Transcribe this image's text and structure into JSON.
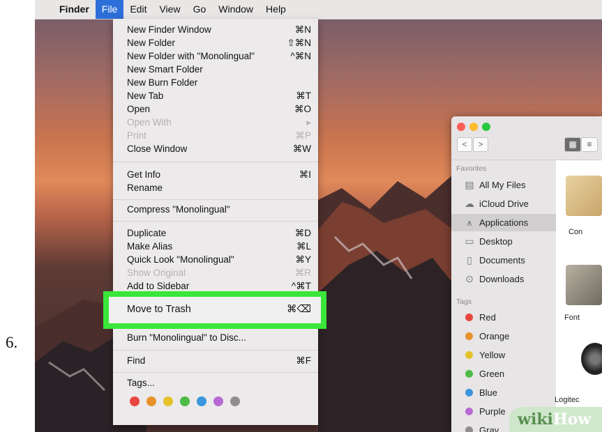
{
  "step_number": "6.",
  "menubar": {
    "apple": "",
    "app": "Finder",
    "items": [
      "File",
      "Edit",
      "View",
      "Go",
      "Window",
      "Help"
    ]
  },
  "file_menu": {
    "groups": [
      [
        {
          "label": "New Finder Window",
          "shortcut": "⌘N",
          "enabled": true
        },
        {
          "label": "New Folder",
          "shortcut": "⇧⌘N",
          "enabled": true
        },
        {
          "label": "New Folder with \"Monolingual\"",
          "shortcut": "^⌘N",
          "enabled": true
        },
        {
          "label": "New Smart Folder",
          "shortcut": "",
          "enabled": true
        },
        {
          "label": "New Burn Folder",
          "shortcut": "",
          "enabled": true
        },
        {
          "label": "New Tab",
          "shortcut": "⌘T",
          "enabled": true
        },
        {
          "label": "Open",
          "shortcut": "⌘O",
          "enabled": true
        },
        {
          "label": "Open With",
          "shortcut": "▸",
          "enabled": false
        },
        {
          "label": "Print",
          "shortcut": "⌘P",
          "enabled": false
        },
        {
          "label": "Close Window",
          "shortcut": "⌘W",
          "enabled": true
        }
      ],
      [
        {
          "label": "Get Info",
          "shortcut": "⌘I",
          "enabled": true
        },
        {
          "label": "Rename",
          "shortcut": "",
          "enabled": true
        }
      ],
      [
        {
          "label": "Compress \"Monolingual\"",
          "shortcut": "",
          "enabled": true
        }
      ],
      [
        {
          "label": "Duplicate",
          "shortcut": "⌘D",
          "enabled": true
        },
        {
          "label": "Make Alias",
          "shortcut": "⌘L",
          "enabled": true
        },
        {
          "label": "Quick Look \"Monolingual\"",
          "shortcut": "⌘Y",
          "enabled": true
        },
        {
          "label": "Show Original",
          "shortcut": "⌘R",
          "enabled": false
        },
        {
          "label": "Add to Sidebar",
          "shortcut": "^⌘T",
          "enabled": true
        }
      ]
    ],
    "highlighted": {
      "label": "Move to Trash",
      "shortcut": "⌘⌫",
      "highlight_color": "#39e639"
    },
    "burn": "Burn \"Monolingual\" to Disc...",
    "find": {
      "label": "Find",
      "shortcut": "⌘F"
    },
    "tags_label": "Tags...",
    "tag_colors": [
      "#e8473f",
      "#e8922c",
      "#e6c22a",
      "#4dbb45",
      "#3a95dd",
      "#b86ad4",
      "#8f8d8d"
    ]
  },
  "finder_window": {
    "traffic_lights": [
      "#fc5f57",
      "#fdbc2e",
      "#28c840"
    ],
    "nav": {
      "back": "<",
      "forward": ">"
    },
    "favorites_label": "Favorites",
    "favorites": [
      {
        "label": "All My Files",
        "icon": "all-files-icon"
      },
      {
        "label": "iCloud Drive",
        "icon": "cloud-icon"
      },
      {
        "label": "Applications",
        "icon": "applications-icon",
        "selected": true
      },
      {
        "label": "Desktop",
        "icon": "desktop-icon"
      },
      {
        "label": "Documents",
        "icon": "documents-icon"
      },
      {
        "label": "Downloads",
        "icon": "downloads-icon"
      }
    ],
    "tags_label": "Tags",
    "tags": [
      {
        "label": "Red",
        "color": "#e8473f"
      },
      {
        "label": "Orange",
        "color": "#e8922c"
      },
      {
        "label": "Yellow",
        "color": "#e6c22a"
      },
      {
        "label": "Green",
        "color": "#4dbb45"
      },
      {
        "label": "Blue",
        "color": "#3a95dd"
      },
      {
        "label": "Purple",
        "color": "#b86ad4"
      },
      {
        "label": "Gray",
        "color": "#8f8d8d"
      }
    ],
    "apps": [
      "Con",
      "Font",
      "Logitec"
    ]
  },
  "watermark": {
    "part1": "wiki",
    "part2": "How"
  }
}
